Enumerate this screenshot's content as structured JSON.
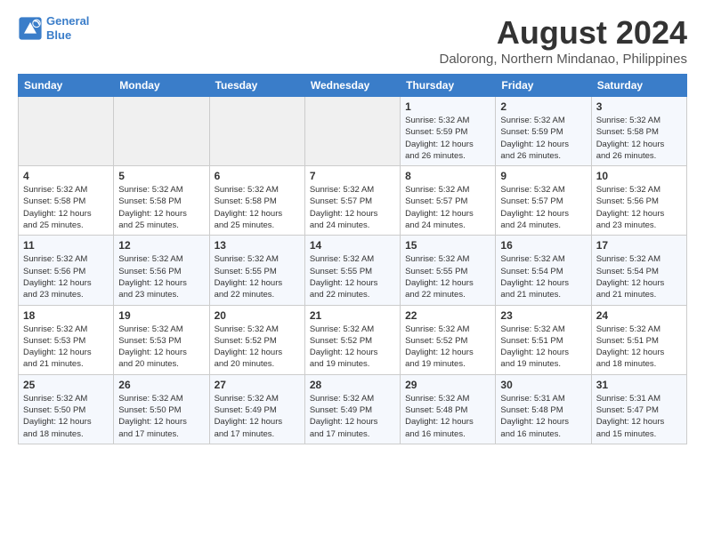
{
  "logo": {
    "line1": "General",
    "line2": "Blue"
  },
  "title": "August 2024",
  "subtitle": "Dalorong, Northern Mindanao, Philippines",
  "weekdays": [
    "Sunday",
    "Monday",
    "Tuesday",
    "Wednesday",
    "Thursday",
    "Friday",
    "Saturday"
  ],
  "weeks": [
    [
      {
        "day": "",
        "content": ""
      },
      {
        "day": "",
        "content": ""
      },
      {
        "day": "",
        "content": ""
      },
      {
        "day": "",
        "content": ""
      },
      {
        "day": "1",
        "content": "Sunrise: 5:32 AM\nSunset: 5:59 PM\nDaylight: 12 hours\nand 26 minutes."
      },
      {
        "day": "2",
        "content": "Sunrise: 5:32 AM\nSunset: 5:59 PM\nDaylight: 12 hours\nand 26 minutes."
      },
      {
        "day": "3",
        "content": "Sunrise: 5:32 AM\nSunset: 5:58 PM\nDaylight: 12 hours\nand 26 minutes."
      }
    ],
    [
      {
        "day": "4",
        "content": "Sunrise: 5:32 AM\nSunset: 5:58 PM\nDaylight: 12 hours\nand 25 minutes."
      },
      {
        "day": "5",
        "content": "Sunrise: 5:32 AM\nSunset: 5:58 PM\nDaylight: 12 hours\nand 25 minutes."
      },
      {
        "day": "6",
        "content": "Sunrise: 5:32 AM\nSunset: 5:58 PM\nDaylight: 12 hours\nand 25 minutes."
      },
      {
        "day": "7",
        "content": "Sunrise: 5:32 AM\nSunset: 5:57 PM\nDaylight: 12 hours\nand 24 minutes."
      },
      {
        "day": "8",
        "content": "Sunrise: 5:32 AM\nSunset: 5:57 PM\nDaylight: 12 hours\nand 24 minutes."
      },
      {
        "day": "9",
        "content": "Sunrise: 5:32 AM\nSunset: 5:57 PM\nDaylight: 12 hours\nand 24 minutes."
      },
      {
        "day": "10",
        "content": "Sunrise: 5:32 AM\nSunset: 5:56 PM\nDaylight: 12 hours\nand 23 minutes."
      }
    ],
    [
      {
        "day": "11",
        "content": "Sunrise: 5:32 AM\nSunset: 5:56 PM\nDaylight: 12 hours\nand 23 minutes."
      },
      {
        "day": "12",
        "content": "Sunrise: 5:32 AM\nSunset: 5:56 PM\nDaylight: 12 hours\nand 23 minutes."
      },
      {
        "day": "13",
        "content": "Sunrise: 5:32 AM\nSunset: 5:55 PM\nDaylight: 12 hours\nand 22 minutes."
      },
      {
        "day": "14",
        "content": "Sunrise: 5:32 AM\nSunset: 5:55 PM\nDaylight: 12 hours\nand 22 minutes."
      },
      {
        "day": "15",
        "content": "Sunrise: 5:32 AM\nSunset: 5:55 PM\nDaylight: 12 hours\nand 22 minutes."
      },
      {
        "day": "16",
        "content": "Sunrise: 5:32 AM\nSunset: 5:54 PM\nDaylight: 12 hours\nand 21 minutes."
      },
      {
        "day": "17",
        "content": "Sunrise: 5:32 AM\nSunset: 5:54 PM\nDaylight: 12 hours\nand 21 minutes."
      }
    ],
    [
      {
        "day": "18",
        "content": "Sunrise: 5:32 AM\nSunset: 5:53 PM\nDaylight: 12 hours\nand 21 minutes."
      },
      {
        "day": "19",
        "content": "Sunrise: 5:32 AM\nSunset: 5:53 PM\nDaylight: 12 hours\nand 20 minutes."
      },
      {
        "day": "20",
        "content": "Sunrise: 5:32 AM\nSunset: 5:52 PM\nDaylight: 12 hours\nand 20 minutes."
      },
      {
        "day": "21",
        "content": "Sunrise: 5:32 AM\nSunset: 5:52 PM\nDaylight: 12 hours\nand 19 minutes."
      },
      {
        "day": "22",
        "content": "Sunrise: 5:32 AM\nSunset: 5:52 PM\nDaylight: 12 hours\nand 19 minutes."
      },
      {
        "day": "23",
        "content": "Sunrise: 5:32 AM\nSunset: 5:51 PM\nDaylight: 12 hours\nand 19 minutes."
      },
      {
        "day": "24",
        "content": "Sunrise: 5:32 AM\nSunset: 5:51 PM\nDaylight: 12 hours\nand 18 minutes."
      }
    ],
    [
      {
        "day": "25",
        "content": "Sunrise: 5:32 AM\nSunset: 5:50 PM\nDaylight: 12 hours\nand 18 minutes."
      },
      {
        "day": "26",
        "content": "Sunrise: 5:32 AM\nSunset: 5:50 PM\nDaylight: 12 hours\nand 17 minutes."
      },
      {
        "day": "27",
        "content": "Sunrise: 5:32 AM\nSunset: 5:49 PM\nDaylight: 12 hours\nand 17 minutes."
      },
      {
        "day": "28",
        "content": "Sunrise: 5:32 AM\nSunset: 5:49 PM\nDaylight: 12 hours\nand 17 minutes."
      },
      {
        "day": "29",
        "content": "Sunrise: 5:32 AM\nSunset: 5:48 PM\nDaylight: 12 hours\nand 16 minutes."
      },
      {
        "day": "30",
        "content": "Sunrise: 5:31 AM\nSunset: 5:48 PM\nDaylight: 12 hours\nand 16 minutes."
      },
      {
        "day": "31",
        "content": "Sunrise: 5:31 AM\nSunset: 5:47 PM\nDaylight: 12 hours\nand 15 minutes."
      }
    ]
  ]
}
